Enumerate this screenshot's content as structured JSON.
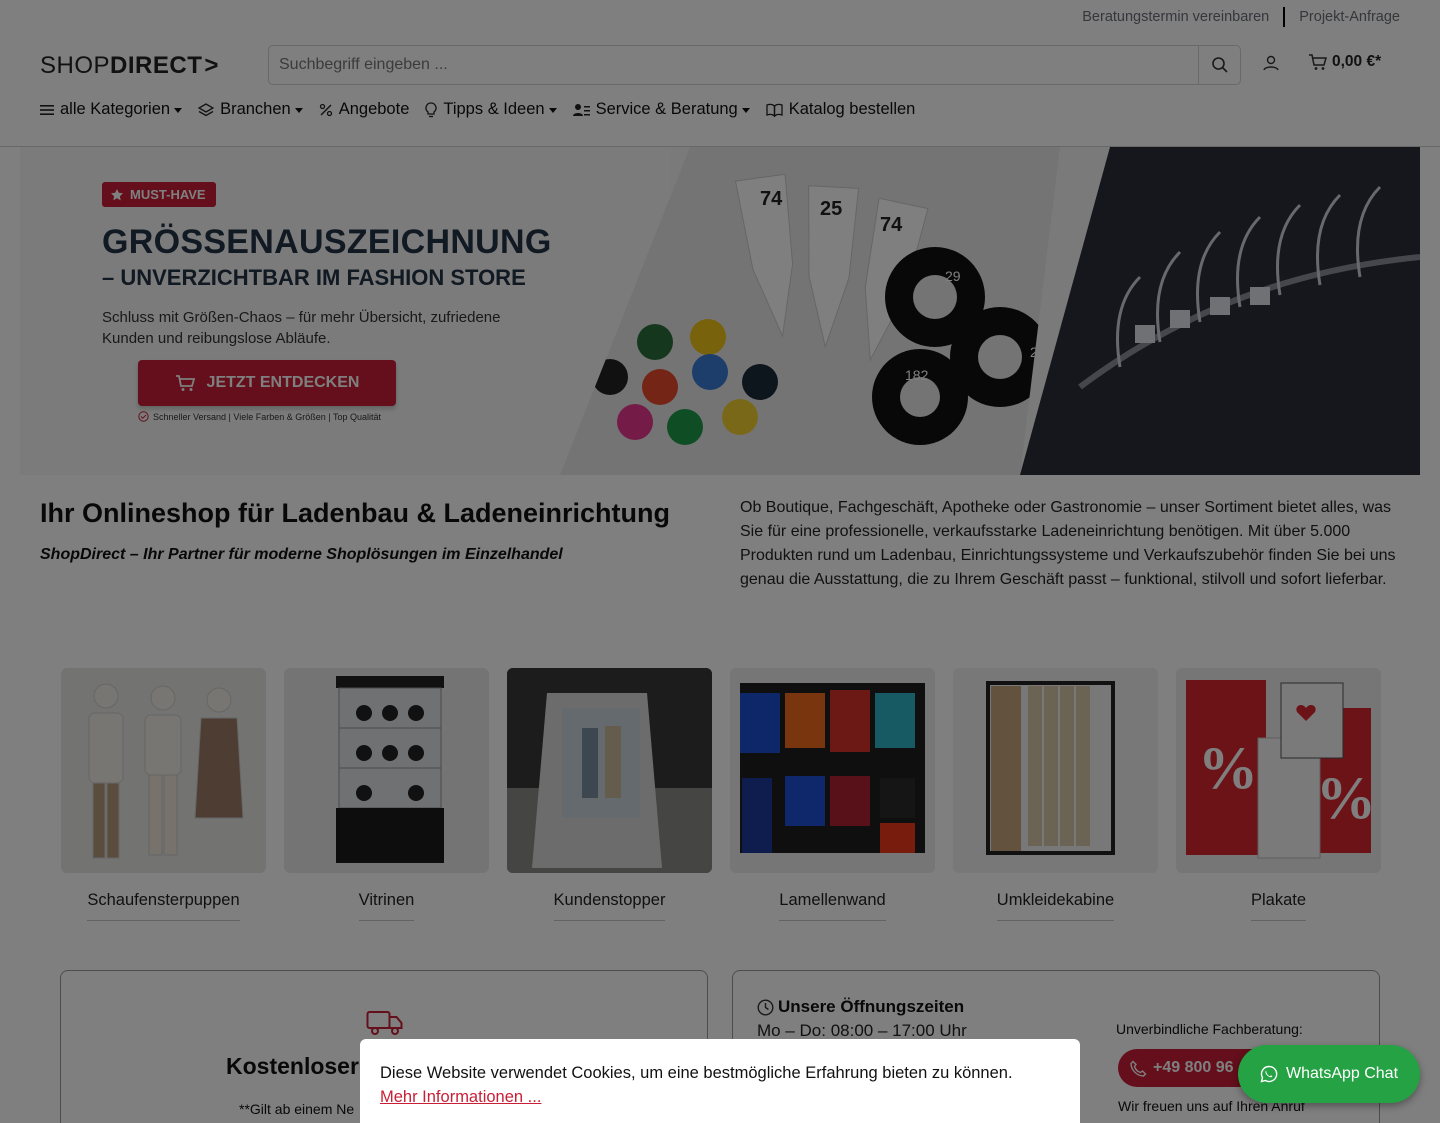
{
  "topbar": {
    "link1": "Beratungstermin vereinbaren",
    "link2": "Projekt-Anfrage"
  },
  "logo": {
    "part1": "SHOP",
    "part2": "DIRECT",
    "arrow": ">"
  },
  "search": {
    "placeholder": "Suchbegriff eingeben ..."
  },
  "cart": {
    "total": "0,00 €*"
  },
  "nav": [
    {
      "label": "alle Kategorien",
      "icon": "menu-icon",
      "dropdown": true
    },
    {
      "label": "Branchen",
      "icon": "layers-icon",
      "dropdown": true
    },
    {
      "label": "Angebote",
      "icon": "percent-icon",
      "dropdown": false
    },
    {
      "label": "Tipps & Ideen",
      "icon": "lightbulb-icon",
      "dropdown": true
    },
    {
      "label": "Service & Beratung",
      "icon": "person-list-icon",
      "dropdown": true
    },
    {
      "label": "Katalog bestellen",
      "icon": "book-icon",
      "dropdown": false
    }
  ],
  "hero": {
    "badge": "MUST-HAVE",
    "title": "GRÖSSENAUSZEICHNUNG",
    "subtitle": "– UNVERZICHTBAR IM FASHION STORE",
    "text": "Schluss mit Größen-Chaos – für mehr Übersicht, zufriedene Kunden und reibungslose Abläufe.",
    "cta": "JETZT ENTDECKEN",
    "note": "Schneller Versand | Viele Farben & Größen | Top Qualität",
    "tags": [
      "74",
      "25",
      "74",
      "182",
      "29",
      "29",
      "182",
      "29",
      "182"
    ]
  },
  "intro": {
    "title": "Ihr Onlineshop für Ladenbau & Ladeneinrichtung",
    "tagline": "ShopDirect – Ihr Partner für moderne Shoplösungen im Einzelhandel",
    "description": "Ob Boutique, Fachgeschäft, Apotheke oder Gastronomie – unser Sortiment bietet alles, was Sie für eine professionelle, verkaufsstarke Ladeneinrichtung benötigen. Mit über 5.000 Produkten rund um Ladenbau, Einrichtungssysteme und Verkaufszubehör finden Sie bei uns genau die Ausstattung, die zu Ihrem Geschäft passt – funktional, stilvoll und sofort lieferbar."
  },
  "categories": [
    {
      "label": "Schaufensterpuppen"
    },
    {
      "label": "Vitrinen"
    },
    {
      "label": "Kundenstopper"
    },
    {
      "label": "Lamellenwand"
    },
    {
      "label": "Umkleidekabine"
    },
    {
      "label": "Plakate"
    }
  ],
  "shipping": {
    "title": "Kostenloser",
    "note": "**Gilt ab einem Ne"
  },
  "contact": {
    "hours_title": "Unsere Öffnungszeiten",
    "hours": "Mo – Do: 08:00 – 17:00 Uhr",
    "consult": "Unverbindliche Fachberatung:",
    "phone": "+49 800 96",
    "glad": "Wir freuen uns auf Ihren Anruf"
  },
  "cookie": {
    "text": "Diese Website verwendet Cookies, um eine bestmögliche Erfahrung bieten zu können.",
    "link": "Mehr Informationen ..."
  },
  "whatsapp": {
    "label": "WhatsApp Chat"
  },
  "colors": {
    "brand_red": "#c81f37",
    "whatsapp_green": "#25a244",
    "overlay": "rgba(0,0,0,0.5)"
  }
}
